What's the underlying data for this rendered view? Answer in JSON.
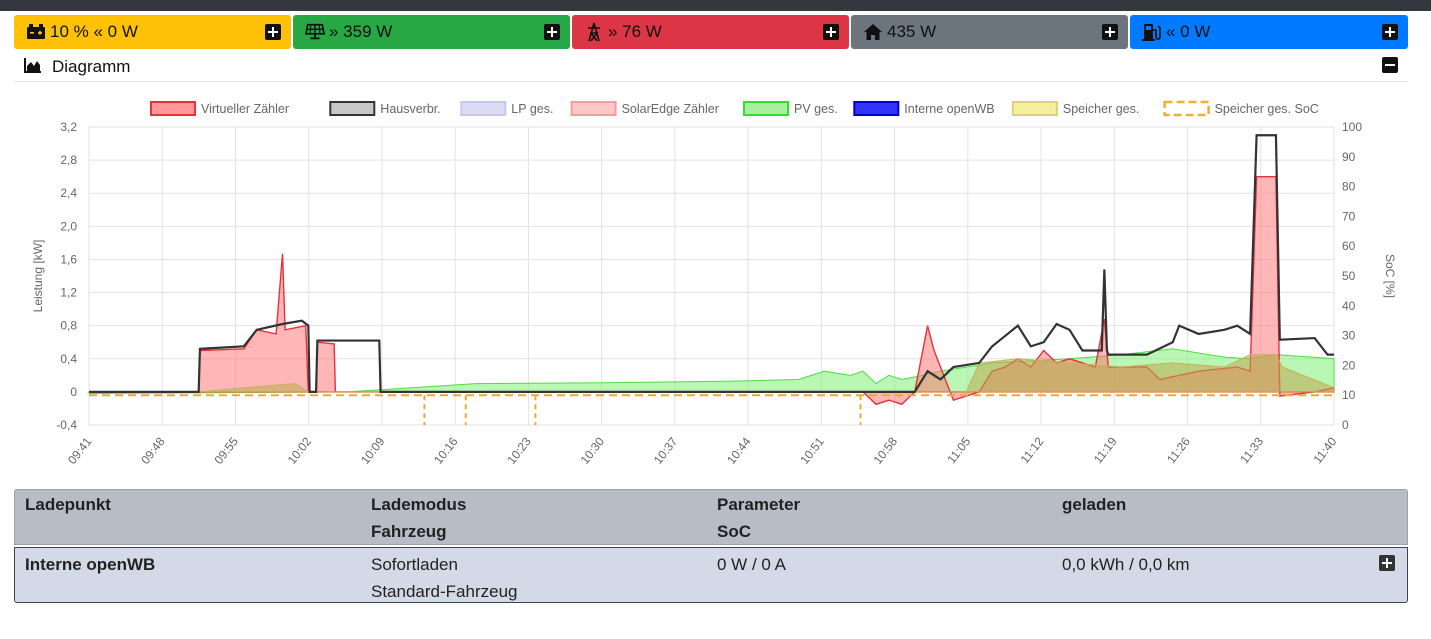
{
  "tiles": [
    {
      "icon": "battery-icon",
      "value": "10 % « 0 W",
      "color": "#ffc107"
    },
    {
      "icon": "solar-panel-icon",
      "value": "» 359 W",
      "color": "#28a745"
    },
    {
      "icon": "power-tower-icon",
      "value": "» 76 W",
      "color": "#dc3545"
    },
    {
      "icon": "home-icon",
      "value": "435 W",
      "color": "#6c757d"
    },
    {
      "icon": "charging-station-icon",
      "value": "« 0 W",
      "color": "#007bff"
    }
  ],
  "diagram": {
    "title": "Diagramm"
  },
  "chart_data": {
    "type": "area",
    "ylabel": "Leistung [kW]",
    "y2label": "SoC [%]",
    "ylim": [
      -0.4,
      3.2
    ],
    "y2lim": [
      0,
      100
    ],
    "yticks": [
      "3,2",
      "2,8",
      "2,4",
      "2,0",
      "1,6",
      "1,2",
      "0,8",
      "0,4",
      "0",
      "-0,4"
    ],
    "y2ticks": [
      "100",
      "90",
      "80",
      "70",
      "60",
      "50",
      "40",
      "30",
      "20",
      "10",
      "0"
    ],
    "xticks": [
      "09:41",
      "09:48",
      "09:55",
      "10:02",
      "10:09",
      "10:16",
      "10:23",
      "10:30",
      "10:37",
      "10:44",
      "10:51",
      "10:58",
      "11:05",
      "11:12",
      "11:19",
      "11:26",
      "11:33",
      "11:40"
    ],
    "legend": [
      {
        "name": "Virtueller Zähler",
        "fill": "#ff9999",
        "stroke": "#e8313f"
      },
      {
        "name": "Hausverbr.",
        "fill": "#c8c8c8",
        "stroke": "#333333"
      },
      {
        "name": "LP ges.",
        "fill": "#dcdcf5",
        "stroke": "#c8c8ee"
      },
      {
        "name": "SolarEdge Zähler",
        "fill": "#ffc8c8",
        "stroke": "#f29c9c"
      },
      {
        "name": "PV ges.",
        "fill": "#a8f0a0",
        "stroke": "#33dd33"
      },
      {
        "name": "Interne openWB",
        "fill": "#3333ff",
        "stroke": "#0000cc"
      },
      {
        "name": "Speicher ges.",
        "fill": "#f5f0a0",
        "stroke": "#e0d070"
      },
      {
        "name": "Speicher ges. SoC",
        "fill": "#ffffff",
        "stroke": "#f0b030",
        "dashed": true
      }
    ],
    "series": [
      {
        "name": "Hausverbr.",
        "points": [
          [
            0,
            0
          ],
          [
            8.5,
            0
          ],
          [
            8.6,
            0.52
          ],
          [
            12,
            0.55
          ],
          [
            13,
            0.75
          ],
          [
            15,
            0.82
          ],
          [
            16.5,
            0.86
          ],
          [
            17,
            0.8
          ],
          [
            17.1,
            0
          ],
          [
            17.6,
            0
          ],
          [
            17.7,
            0.62
          ],
          [
            22.5,
            0.62
          ],
          [
            22.6,
            0
          ],
          [
            64,
            0
          ],
          [
            65,
            0.25
          ],
          [
            66,
            0.15
          ],
          [
            67,
            0.3
          ],
          [
            69,
            0.35
          ],
          [
            70,
            0.55
          ],
          [
            72,
            0.8
          ],
          [
            73,
            0.55
          ],
          [
            74,
            0.6
          ],
          [
            75,
            0.82
          ],
          [
            76,
            0.75
          ],
          [
            77,
            0.5
          ],
          [
            78.5,
            0.5
          ],
          [
            78.7,
            1.48
          ],
          [
            78.9,
            0.5
          ],
          [
            79,
            0.45
          ],
          [
            82,
            0.45
          ],
          [
            84,
            0.6
          ],
          [
            84.5,
            0.8
          ],
          [
            86,
            0.7
          ],
          [
            88,
            0.75
          ],
          [
            89,
            0.8
          ],
          [
            90,
            0.7
          ],
          [
            90.5,
            3.1
          ],
          [
            92,
            3.1
          ],
          [
            92.3,
            0.63
          ],
          [
            95,
            0.65
          ],
          [
            96,
            0.45
          ],
          [
            96.5,
            0.45
          ]
        ]
      },
      {
        "name": "Virtueller Zähler",
        "points": [
          [
            0,
            0
          ],
          [
            8.5,
            0
          ],
          [
            8.6,
            0.5
          ],
          [
            12,
            0.52
          ],
          [
            13,
            0.75
          ],
          [
            14.5,
            0.7
          ],
          [
            15,
            1.67
          ],
          [
            15.2,
            0.75
          ],
          [
            16.8,
            0.8
          ],
          [
            17,
            0
          ],
          [
            17.6,
            0
          ],
          [
            17.7,
            0.6
          ],
          [
            19,
            0.58
          ],
          [
            19.1,
            0
          ],
          [
            60,
            0
          ],
          [
            61,
            -0.15
          ],
          [
            62,
            -0.1
          ],
          [
            63,
            -0.15
          ],
          [
            64,
            0
          ],
          [
            65,
            0.8
          ],
          [
            65.5,
            0.5
          ],
          [
            66,
            0.3
          ],
          [
            67,
            -0.1
          ],
          [
            68,
            -0.05
          ],
          [
            69,
            0
          ],
          [
            70,
            0.25
          ],
          [
            71,
            0.3
          ],
          [
            72,
            0.4
          ],
          [
            73,
            0.3
          ],
          [
            74,
            0.5
          ],
          [
            75,
            0.35
          ],
          [
            76,
            0.4
          ],
          [
            78,
            0.3
          ],
          [
            78.7,
            0.88
          ],
          [
            79,
            0.3
          ],
          [
            82,
            0.3
          ],
          [
            83,
            0.15
          ],
          [
            86,
            0.25
          ],
          [
            89,
            0.3
          ],
          [
            90,
            0.25
          ],
          [
            90.5,
            2.6
          ],
          [
            92,
            2.6
          ],
          [
            92.3,
            -0.05
          ],
          [
            95,
            0
          ],
          [
            96.5,
            0.05
          ]
        ]
      },
      {
        "name": "PV ges.",
        "points": [
          [
            0,
            -0.02
          ],
          [
            20,
            0
          ],
          [
            25,
            0.05
          ],
          [
            30,
            0.1
          ],
          [
            40,
            0.11
          ],
          [
            50,
            0.13
          ],
          [
            55,
            0.15
          ],
          [
            57,
            0.25
          ],
          [
            59,
            0.2
          ],
          [
            60,
            0.25
          ],
          [
            61,
            0.1
          ],
          [
            62,
            0.2
          ],
          [
            63,
            0.15
          ],
          [
            64,
            0.18
          ],
          [
            66,
            0.25
          ],
          [
            70,
            0.35
          ],
          [
            76,
            0.4
          ],
          [
            80,
            0.45
          ],
          [
            84,
            0.52
          ],
          [
            88,
            0.42
          ],
          [
            90,
            0.4
          ],
          [
            92,
            0.45
          ],
          [
            96.5,
            0.4
          ]
        ]
      },
      {
        "name": "Speicher ges.",
        "points": [
          [
            0,
            0
          ],
          [
            8.5,
            0
          ],
          [
            12,
            0.05
          ],
          [
            16,
            0.1
          ],
          [
            17,
            0
          ],
          [
            68,
            0
          ],
          [
            69,
            0.35
          ],
          [
            72,
            0.4
          ],
          [
            76,
            0.35
          ],
          [
            80,
            0.3
          ],
          [
            84,
            0.35
          ],
          [
            88,
            0.3
          ],
          [
            90,
            0.45
          ],
          [
            92,
            0.45
          ],
          [
            92.5,
            0.3
          ],
          [
            96.5,
            0.05
          ]
        ]
      },
      {
        "name": "Speicher ges. SoC",
        "points": [
          [
            0,
            10
          ],
          [
            96.5,
            10
          ]
        ]
      }
    ]
  },
  "table": {
    "header": {
      "col1": "Ladepunkt",
      "col2a": "Lademodus",
      "col2b": "Fahrzeug",
      "col3a": "Parameter",
      "col3b": "SoC",
      "col4": "geladen"
    },
    "rows": [
      {
        "name": "Interne openWB",
        "mode": "Sofortladen",
        "vehicle": "Standard-Fahrzeug",
        "param": "0 W / 0 A",
        "charged": "0,0 kWh / 0,0 km"
      }
    ]
  }
}
